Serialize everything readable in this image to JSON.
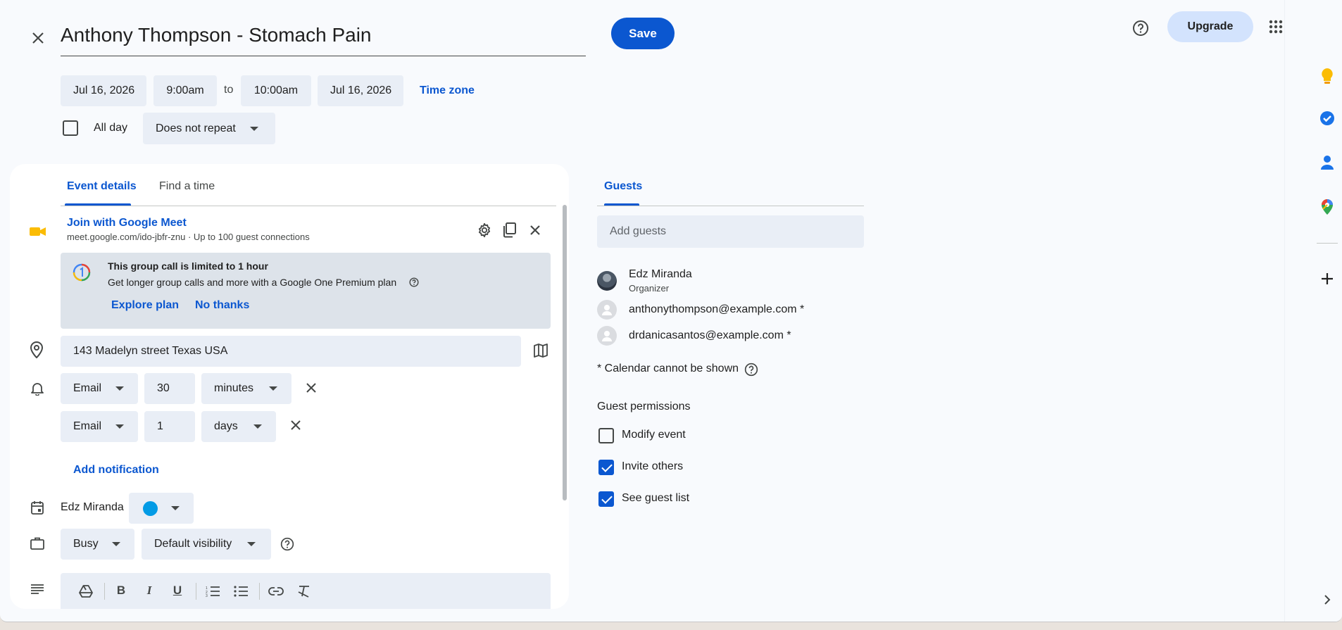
{
  "header": {
    "title": "Anthony Thompson - Stomach Pain",
    "save_label": "Save",
    "upgrade_label": "Upgrade"
  },
  "datetime": {
    "start_date": "Jul 16, 2026",
    "start_time": "9:00am",
    "to_label": "to",
    "end_time": "10:00am",
    "end_date": "Jul 16, 2026",
    "timezone_label": "Time zone",
    "allday_label": "All day",
    "repeat_value": "Does not repeat"
  },
  "tabs": {
    "event_details": "Event details",
    "find_time": "Find a time"
  },
  "meet": {
    "join_label": "Join with Google Meet",
    "info": "meet.google.com/ido-jbfr-znu · Up to 100 guest connections",
    "notice_title": "This group call is limited to 1 hour",
    "notice_body": "Get longer group calls and more with a Google One Premium plan",
    "explore_label": "Explore plan",
    "no_thanks_label": "No thanks"
  },
  "location": {
    "value": "143 Madelyn street  Texas USA"
  },
  "notifications": [
    {
      "method": "Email",
      "amount": "30",
      "unit": "minutes"
    },
    {
      "method": "Email",
      "amount": "1",
      "unit": "days"
    }
  ],
  "add_notification_label": "Add notification",
  "calendar": {
    "owner": "Edz Miranda",
    "color": "#039be5"
  },
  "availability": {
    "status": "Busy",
    "visibility": "Default visibility"
  },
  "guests": {
    "tab_label": "Guests",
    "add_placeholder": "Add guests",
    "list": [
      {
        "name": "Edz Miranda",
        "role": "Organizer"
      },
      {
        "name": "anthonythompson@example.com *"
      },
      {
        "name": "drdanicasantos@example.com *"
      }
    ],
    "calendar_note": "* Calendar cannot be shown",
    "permissions_title": "Guest permissions",
    "permissions": [
      {
        "label": "Modify event",
        "checked": false
      },
      {
        "label": "Invite others",
        "checked": true
      },
      {
        "label": "See guest list",
        "checked": true
      }
    ]
  },
  "colors": {
    "accent": "#0b57d0",
    "field_bg": "#e9eef6"
  }
}
